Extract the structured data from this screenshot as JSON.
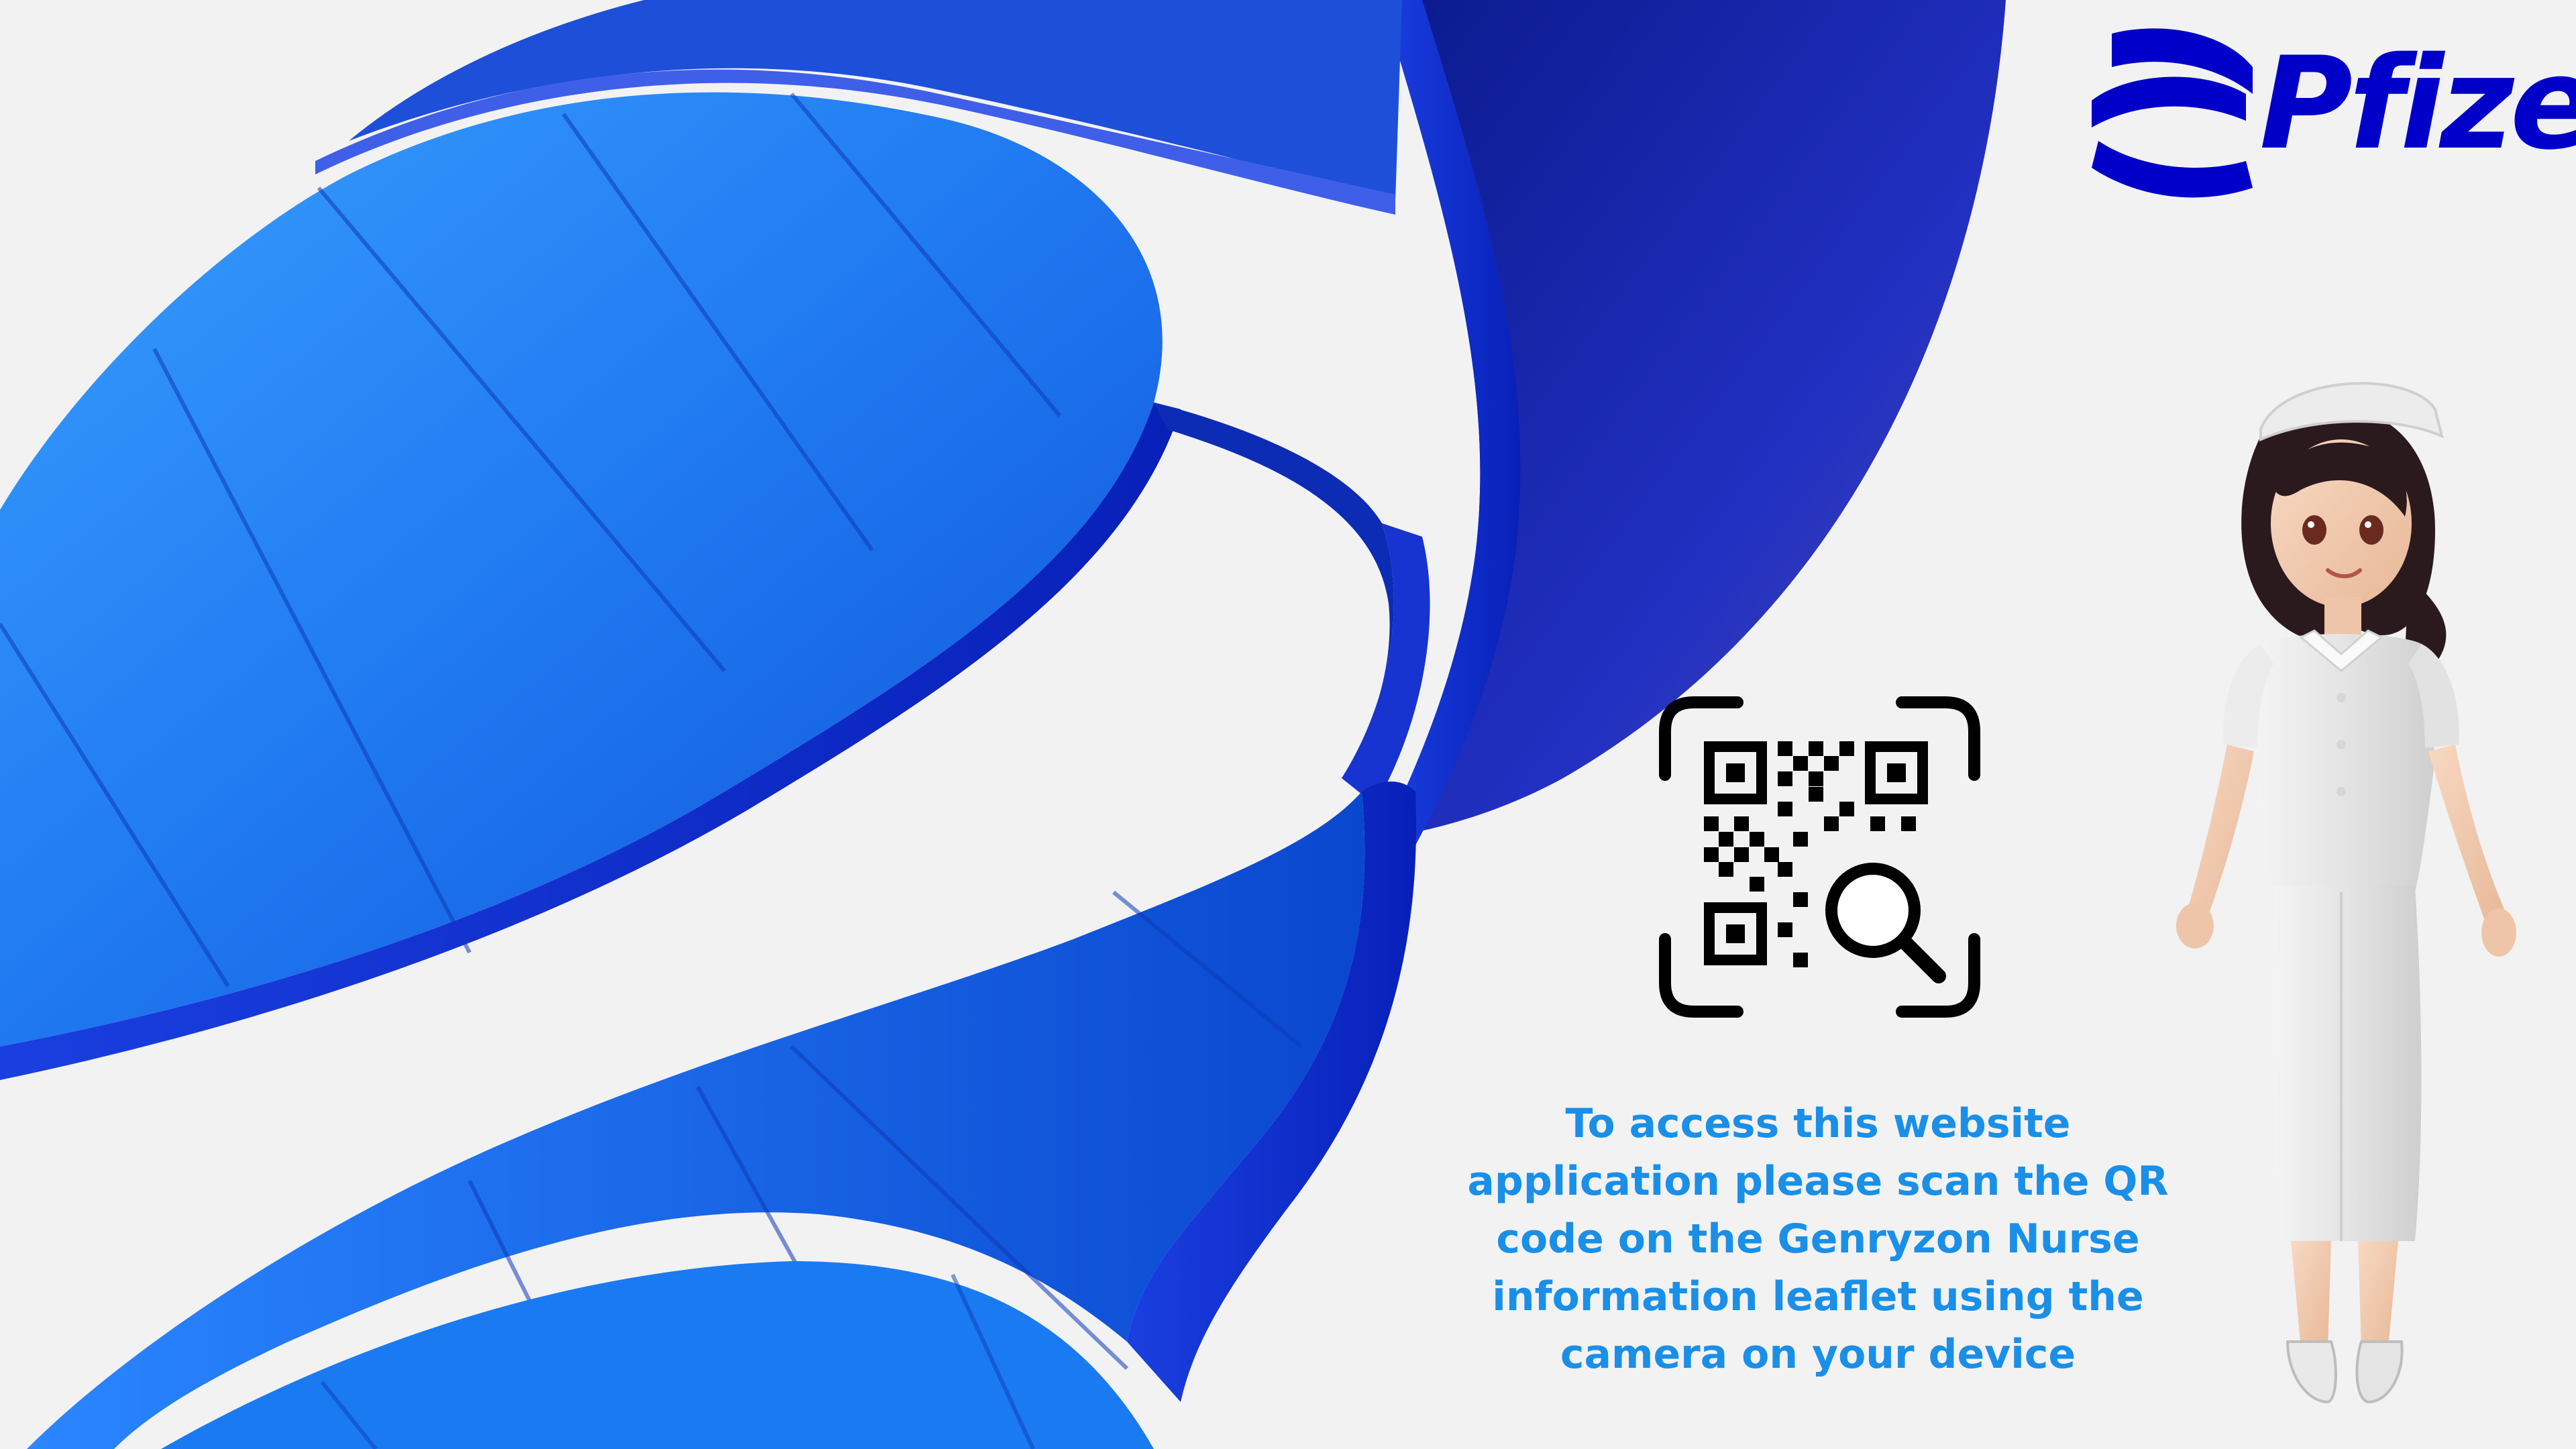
{
  "brand": {
    "name": "Pfizer",
    "primary_color": "#0000c9",
    "accent_color": "#1a8fe8"
  },
  "icons": {
    "logo_mark": "pfizer-logo-icon",
    "qr": "qr-code-scan-icon",
    "search": "magnifier-icon",
    "hero": "dna-helix-illustration",
    "mascot": "nurse-character-illustration"
  },
  "instructions": {
    "lines": [
      "To access this website",
      "application please scan the QR",
      "code on the Genryzon Nurse",
      "information leaflet using the",
      "camera on your device"
    ]
  }
}
